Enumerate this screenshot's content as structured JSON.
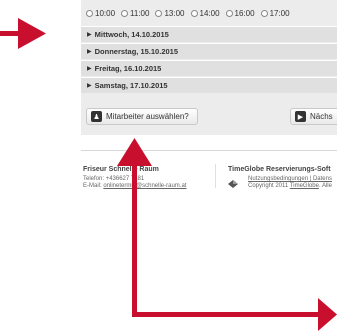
{
  "times": [
    "10:00",
    "11:00",
    "13:00",
    "14:00",
    "16:00",
    "17:00"
  ],
  "days": [
    "Mittwoch, 14.10.2015",
    "Donnerstag, 15.10.2015",
    "Freitag, 16.10.2015",
    "Samstag, 17.10.2015"
  ],
  "buttons": {
    "choose_staff": "Mitarbeiter auswählen?",
    "next": "Nächs"
  },
  "footer": {
    "left": {
      "title": "Friseur Schnelle Raum",
      "phone_label": "Telefon:",
      "phone": "+436627 7181",
      "email_label": "E-Mail:",
      "email": "onlinetermin@schnelle-raum.at"
    },
    "right": {
      "title": "TimeGlobe Reservierungs-Soft",
      "links": "Nutzungsbedingungen | Datens",
      "copyright_prefix": "Copyright 2011",
      "copyright_link": "TimeGlobe",
      "copyright_suffix": ". Alle"
    }
  },
  "colors": {
    "arrow": "#c8102e",
    "panel": "#ececec",
    "day_row": "#e0e0e0"
  },
  "icons": {
    "staff": "user-icon",
    "next": "arrow-right-icon",
    "day": "triangle-right-icon"
  }
}
